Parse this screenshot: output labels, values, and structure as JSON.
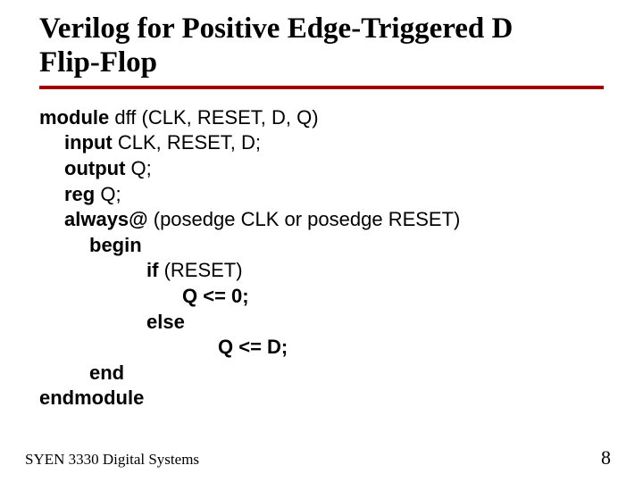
{
  "slide": {
    "title_line1": "Verilog for  Positive Edge-Triggered D",
    "title_line2": "Flip-Flop"
  },
  "code": {
    "kw_module": "module",
    "module_sig": " dff (CLK, RESET, D, Q)",
    "kw_input": "input",
    "input_sig": " CLK, RESET, D;",
    "kw_output": "output",
    "output_sig": " Q;",
    "kw_reg": "reg",
    "reg_sig": " Q;",
    "kw_always": "always@",
    "always_sig": " (posedge CLK or posedge RESET)",
    "kw_begin": "begin",
    "kw_if": "if",
    "if_sig": " (RESET)",
    "stmt_reset": "Q <= 0;",
    "kw_else": "else",
    "stmt_d": "Q <= D;",
    "kw_end": "end",
    "kw_endmodule": "endmodule"
  },
  "footer": {
    "course": "SYEN 3330 Digital Systems",
    "page": "8"
  }
}
